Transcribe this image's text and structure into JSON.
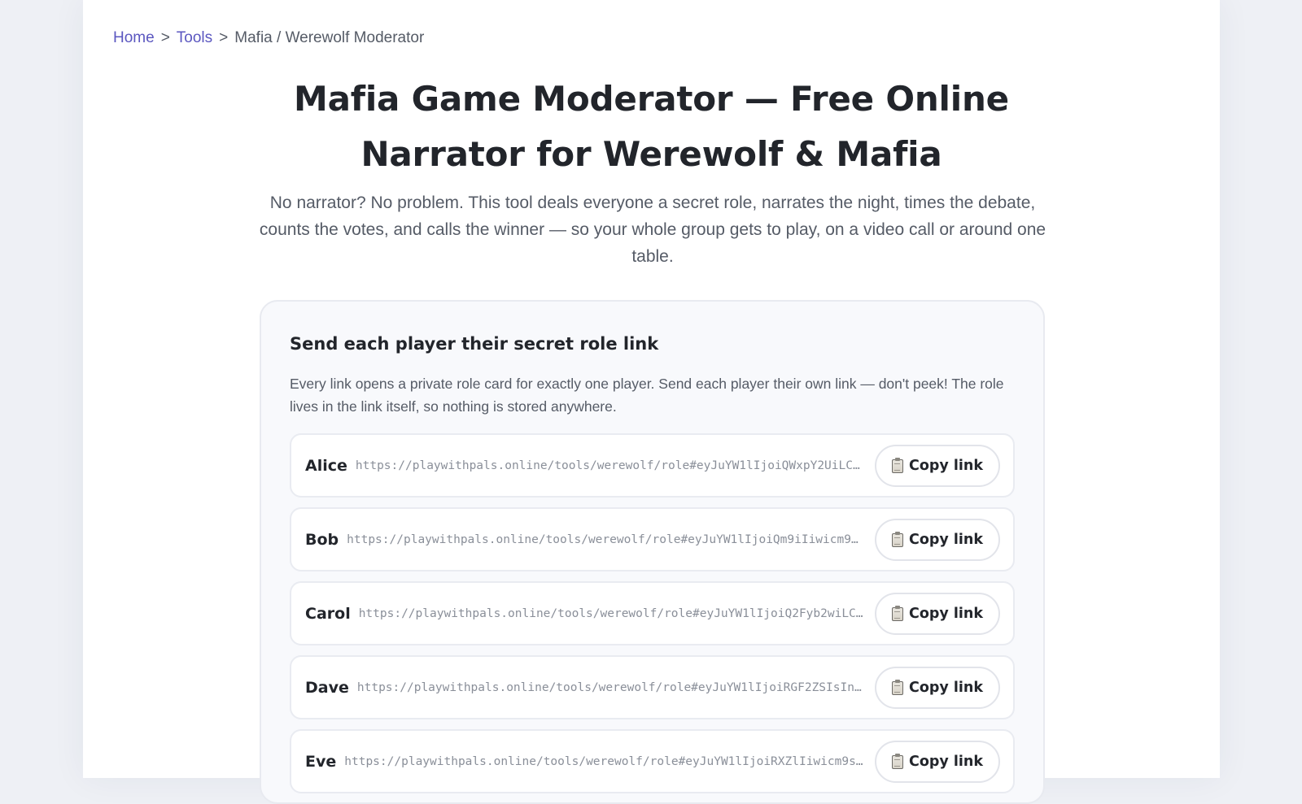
{
  "breadcrumb": {
    "home": "Home",
    "tools": "Tools",
    "current": "Mafia / Werewolf Moderator",
    "separator": ">"
  },
  "header": {
    "title_line1": "Mafia Game Moderator — Free Online",
    "title_line2": "Narrator for Werewolf & Mafia",
    "subtitle": "No narrator? No problem. This tool deals everyone a secret role, narrates the night, times the debate, counts the votes, and calls the winner — so your whole group gets to play, on a video call or around one table."
  },
  "card": {
    "title": "Send each player their secret role link",
    "description": "Every link opens a private role card for exactly one player. Send each player their own link — don't peek! The role lives in the link itself, so nothing is stored anywhere.",
    "copy_label": "Copy link",
    "copy_icon": "clipboard-icon",
    "players": [
      {
        "name": "Alice",
        "link": "https://playwithpals.online/tools/werewolf/role#eyJuYW1lIjoiQWxpY2UiLCJ…"
      },
      {
        "name": "Bob",
        "link": "https://playwithpals.online/tools/werewolf/role#eyJuYW1lIjoiQm9iIiwicm9s…"
      },
      {
        "name": "Carol",
        "link": "https://playwithpals.online/tools/werewolf/role#eyJuYW1lIjoiQ2Fyb2wiLC…"
      },
      {
        "name": "Dave",
        "link": "https://playwithpals.online/tools/werewolf/role#eyJuYW1lIjoiRGF2ZSIsInJ…"
      },
      {
        "name": "Eve",
        "link": "https://playwithpals.online/tools/werewolf/role#eyJuYW1lIjoiRXZlIiwicm9s…"
      }
    ]
  },
  "colors": {
    "link": "#5b57c0",
    "text": "#22252b",
    "muted": "#555b66",
    "background": "#eef0f5"
  }
}
